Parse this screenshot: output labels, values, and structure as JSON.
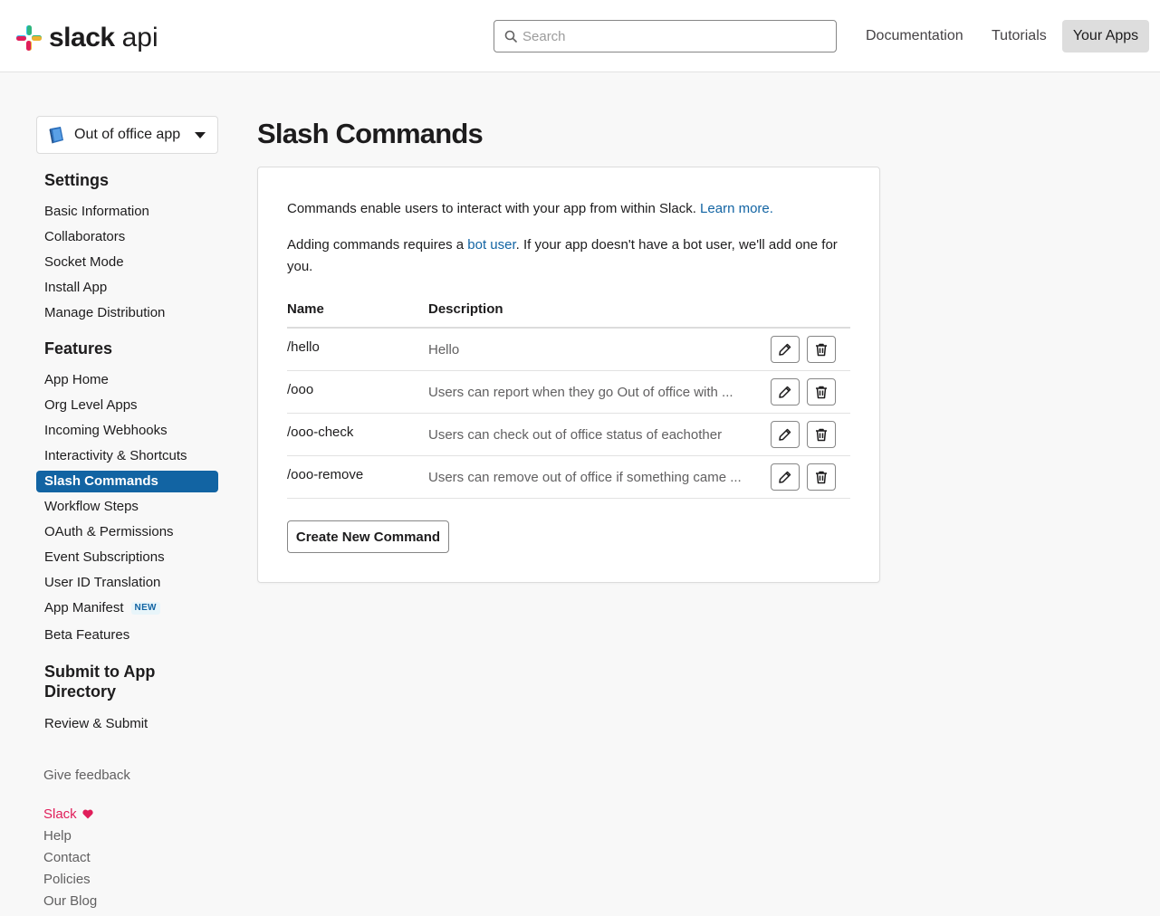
{
  "header": {
    "logo_word": "slack",
    "logo_api": "api",
    "search_placeholder": "Search",
    "nav": [
      "Documentation",
      "Tutorials",
      "Your Apps"
    ]
  },
  "sidebar": {
    "app_name": "Out of office app",
    "settings_heading": "Settings",
    "settings_items": [
      "Basic Information",
      "Collaborators",
      "Socket Mode",
      "Install App",
      "Manage Distribution"
    ],
    "features_heading": "Features",
    "features_items": [
      "App Home",
      "Org Level Apps",
      "Incoming Webhooks",
      "Interactivity & Shortcuts",
      "Slash Commands",
      "Workflow Steps",
      "OAuth & Permissions",
      "Event Subscriptions",
      "User ID Translation",
      "App Manifest",
      "Beta Features"
    ],
    "active_item": "Slash Commands",
    "new_badge": "NEW",
    "submit_heading_line1": "Submit to App",
    "submit_heading_line2": "Directory",
    "submit_items": [
      "Review & Submit"
    ],
    "give_feedback": "Give feedback",
    "footer_links": [
      "Slack",
      "Help",
      "Contact",
      "Policies",
      "Our Blog"
    ]
  },
  "main": {
    "title": "Slash Commands",
    "intro_text": "Commands enable users to interact with your app from within Slack.",
    "learn_more": "Learn more.",
    "bot_text_before": "Adding commands requires a",
    "bot_user_link": "bot user",
    "bot_text_after": ". If your app doesn't have a bot user, we'll add one for you.",
    "table": {
      "headers": [
        "Name",
        "Description"
      ],
      "rows": [
        {
          "command": "/hello",
          "description": "Hello"
        },
        {
          "command": "/ooo",
          "description": "Users can report when they go Out of office with ..."
        },
        {
          "command": "/ooo-check",
          "description": "Users can check out of office status of eachother"
        },
        {
          "command": "/ooo-remove",
          "description": "Users can remove out of office if something came ..."
        }
      ]
    },
    "create_button": "Create New Command"
  },
  "colors": {
    "accent": "#1264a3",
    "love": "#e01e5a"
  }
}
